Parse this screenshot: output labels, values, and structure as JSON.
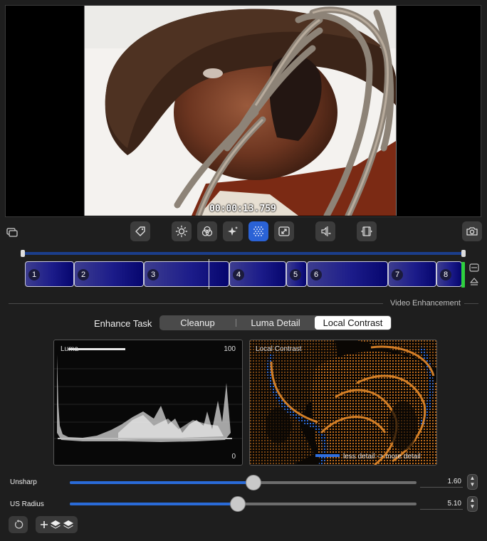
{
  "video": {
    "timecode": "00:00:13.759"
  },
  "toolbar": {
    "buttons": [
      {
        "name": "tag-icon"
      },
      {
        "name": "brightness-icon"
      },
      {
        "name": "color-circles-icon"
      },
      {
        "name": "sparkle-icon"
      },
      {
        "name": "dot-grid-icon",
        "active": true
      },
      {
        "name": "resize-icon"
      },
      {
        "name": "audio-trim-icon"
      },
      {
        "name": "film-strip-icon"
      },
      {
        "name": "camera-icon"
      }
    ],
    "left_icon": "window-stack-icon"
  },
  "timeline": {
    "segments": [
      {
        "label": "1"
      },
      {
        "label": "2"
      },
      {
        "label": "3"
      },
      {
        "label": "4"
      },
      {
        "label": "5"
      },
      {
        "label": "6"
      },
      {
        "label": "7"
      },
      {
        "label": "8"
      }
    ]
  },
  "section": {
    "title": "Video Enhancement"
  },
  "enhance": {
    "label": "Enhance Task",
    "options": [
      "Cleanup",
      "Luma Detail",
      "Local Contrast"
    ],
    "selected": "Local Contrast"
  },
  "luma_panel": {
    "title": "Luma",
    "max_label": "100",
    "min_label": "0"
  },
  "contrast_panel": {
    "title": "Local Contrast",
    "legend": "less detail -> more detail"
  },
  "sliders": [
    {
      "label": "Unsharp",
      "value": "1.60",
      "fraction": 0.53
    },
    {
      "label": "US Radius",
      "value": "5.10",
      "fraction": 0.485
    }
  ],
  "colors": {
    "accent": "#2a6bd8",
    "segment": "#1c1c8a",
    "active_marker": "#2fcf3f",
    "contrast_orange": "#d6781e",
    "contrast_blue": "#2f6fe0"
  }
}
